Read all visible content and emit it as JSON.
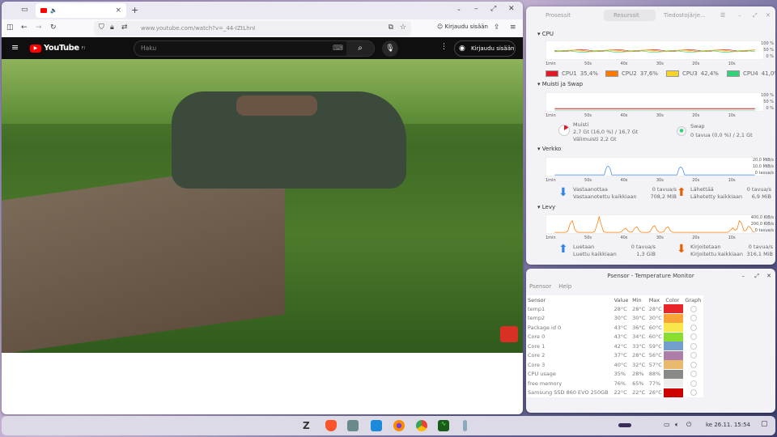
{
  "browser": {
    "url": "www.youtube.com/watch?v=_44-IZtLhnI",
    "signin": "Kirjaudu sisään",
    "new_tab": "+",
    "tab_close": "×"
  },
  "youtube": {
    "logo": "YouTube",
    "region": "FI",
    "search_placeholder": "Haku",
    "signin": "Kirjaudu sisään"
  },
  "sysmon": {
    "tabs": [
      "Prosessit",
      "Resurssit",
      "Tiedostojärje..."
    ],
    "cpu": {
      "title": "CPU",
      "cores": [
        {
          "name": "CPU1",
          "value": "35,4%",
          "color": "#e01b24"
        },
        {
          "name": "CPU2",
          "value": "37,6%",
          "color": "#ff7800"
        },
        {
          "name": "CPU3",
          "value": "42,4%",
          "color": "#f6d32d"
        },
        {
          "name": "CPU4",
          "value": "41,0%",
          "color": "#33d17a"
        }
      ]
    },
    "mem": {
      "title": "Muisti ja Swap",
      "mem_label": "Muisti",
      "mem_value": "2,7 Gt (16,0 %) / 16,7 Gt",
      "cache": "Välimuisti 2,2 Gt",
      "swap_label": "Swap",
      "swap_value": "0 tavua (0,0 %) / 2,1 Gt"
    },
    "net": {
      "title": "Verkko",
      "rx_label": "Vastaanottaa",
      "rx_rate": "0 tavua/s",
      "rx_total_label": "Vastaanotettu kaikkiaan",
      "rx_total": "708,2 MiB",
      "tx_label": "Lähettää",
      "tx_rate": "0 tavua/s",
      "tx_total_label": "Lähetetty kaikkiaan",
      "tx_total": "6,9 MiB",
      "y": [
        "20,0 MiB/s",
        "10,0 MiB/s",
        "0 tavua/s"
      ]
    },
    "disk": {
      "title": "Levy",
      "read_label": "Luetaan",
      "read_rate": "0 tavua/s",
      "read_total_label": "Luettu kaikkiaan",
      "read_total": "1,3 GiB",
      "write_label": "Kirjoitetaan",
      "write_rate": "0 tavua/s",
      "write_total_label": "Kirjoitettu kaikkiaan",
      "write_total": "316,1 MiB",
      "y": [
        "400,0 KiB/s",
        "200,0 KiB/s",
        "0 tavua/s"
      ]
    },
    "x_ticks": [
      "1min",
      "50s",
      "40s",
      "30s",
      "20s",
      "10s"
    ],
    "pct_ticks": [
      "100 %",
      "50 %",
      "0 %"
    ]
  },
  "psensor": {
    "title": "Psensor - Temperature Monitor",
    "menu": [
      "Psensor",
      "Help"
    ],
    "columns": [
      "Sensor",
      "Value",
      "Min",
      "Max",
      "Color",
      "Graph"
    ],
    "rows": [
      [
        "temp1",
        "28°C",
        "28°C",
        "28°C",
        "#e8262a"
      ],
      [
        "temp2",
        "30°C",
        "30°C",
        "30°C",
        "#f8a437"
      ],
      [
        "Package id 0",
        "43°C",
        "36°C",
        "60°C",
        "#f8e64a"
      ],
      [
        "Core 0",
        "43°C",
        "34°C",
        "60°C",
        "#8ade32"
      ],
      [
        "Core 1",
        "42°C",
        "33°C",
        "59°C",
        "#729fcf"
      ],
      [
        "Core 2",
        "37°C",
        "28°C",
        "56°C",
        "#ad7fa8"
      ],
      [
        "Core 3",
        "40°C",
        "32°C",
        "57°C",
        "#e9b96e"
      ],
      [
        "CPU usage",
        "35%",
        "28%",
        "88%",
        "#888a85"
      ],
      [
        "free memory",
        "76%",
        "65%",
        "77%",
        "#eeeeec"
      ],
      [
        "Samsung SSD 860 EVO 250GB",
        "22°C",
        "22°C",
        "26°C",
        "#cc0000"
      ]
    ]
  },
  "taskbar": {
    "clock": "ke 26.11. 15:54"
  }
}
